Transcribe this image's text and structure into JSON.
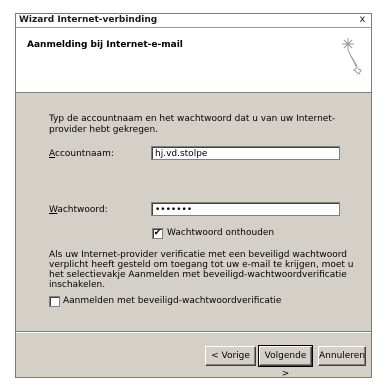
{
  "window": {
    "title": "Wizard Internet-verbinding",
    "close_glyph": "x"
  },
  "header": {
    "title": "Aanmelding bij Internet-e-mail",
    "icon": "wizard-wand-icon"
  },
  "intro_text": "Typ de accountnaam en het wachtwoord dat u van uw Internet-provider hebt gekregen.",
  "account": {
    "label": "Accountnaam:",
    "value": "hj.vd.stolpe"
  },
  "password": {
    "label": "Wachtwoord:",
    "value": "•••••••"
  },
  "remember": {
    "label": "Wachtwoord onthouden",
    "checked": true
  },
  "info_text": "Als uw Internet-provider verificatie met een beveiligd wachtwoord verplicht heeft gesteld om toegang tot uw e-mail te krijgen, moet u het selectievakje Aanmelden met beveiligd-wachtwoordverificatie inschakelen.",
  "spa": {
    "label": "Aanmelden met beveiligd-wachtwoordverificatie",
    "checked": false
  },
  "buttons": {
    "back": "< Vorige",
    "next": "Volgende >",
    "cancel": "Annuleren"
  }
}
